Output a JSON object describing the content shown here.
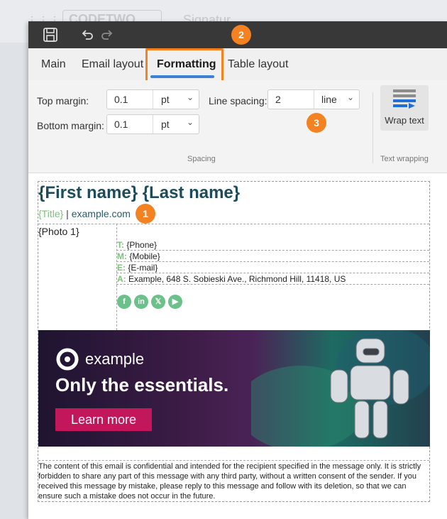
{
  "background": {
    "logo_text": "CODETWO",
    "title_text": "Signatur"
  },
  "toolbar": {
    "save_icon": "save-icon",
    "undo_icon": "undo-icon",
    "redo_icon": "redo-icon"
  },
  "tabs": [
    {
      "label": "Main"
    },
    {
      "label": "Email layout"
    },
    {
      "label": "Formatting",
      "active": true
    },
    {
      "label": "Table layout"
    }
  ],
  "callouts": {
    "one": "1",
    "two": "2",
    "three": "3"
  },
  "ribbon": {
    "top_margin": {
      "label": "Top margin:",
      "value": "0.1",
      "unit": "pt"
    },
    "bottom_margin": {
      "label": "Bottom margin:",
      "value": "0.1",
      "unit": "pt"
    },
    "line_spacing": {
      "label": "Line spacing:",
      "value": "2",
      "unit": "line"
    },
    "spacing_group": "Spacing",
    "wrap_text": "Wrap text",
    "wrapping_group": "Text wrapping"
  },
  "signature": {
    "name": "{First name} {Last name}",
    "title_placeholder": "{Title}",
    "separator": " | ",
    "website": "example.com",
    "photo": "{Photo 1}",
    "contacts": [
      {
        "prefix": "T:",
        "value": " {Phone}"
      },
      {
        "prefix": "M:",
        "value": " {Mobile}"
      },
      {
        "prefix": "E:",
        "value": " {E-mail}"
      },
      {
        "prefix": "A:",
        "value": " Example, 648 S. Sobieski Ave., Richmond Hill, 11418, US"
      }
    ],
    "social_icons": [
      "facebook-icon",
      "linkedin-icon",
      "x-icon",
      "youtube-icon"
    ]
  },
  "banner": {
    "brand": "example",
    "headline": "Only the essentials.",
    "cta": "Learn more"
  },
  "disclaimer": "The content of this email is confidential and intended for the recipient specified in the message only. It is strictly forbidden to share any part of this message with any third party, without a written consent of the sender. If you received this message by mistake, please reply to this message and follow with its deletion, so that we can ensure such a mistake does not occur in the future.",
  "colors": {
    "accent": "#f58220",
    "tab_underline": "#3b82d6",
    "name": "#1c4c5c",
    "contact_label": "#7fbf7f",
    "cta": "#c2185b"
  }
}
